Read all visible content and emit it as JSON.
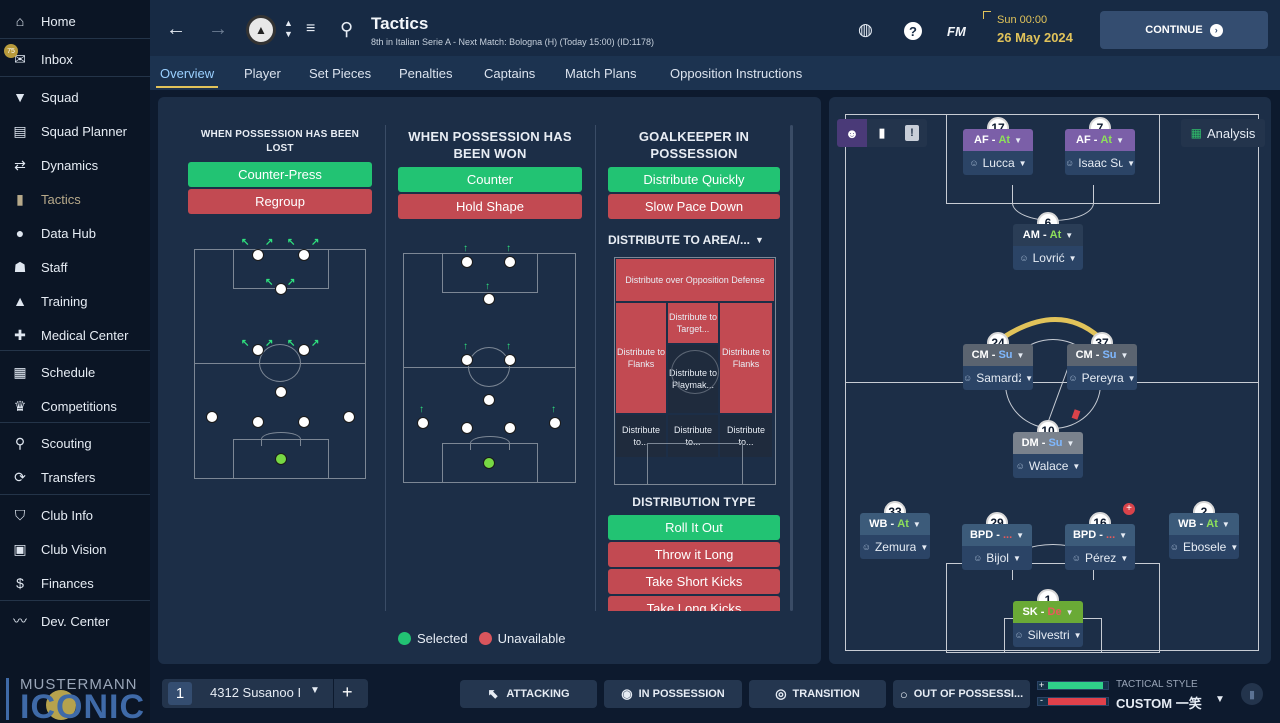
{
  "sidebar": {
    "items": [
      {
        "label": "Home",
        "icon": "home-icon",
        "glyph": "⌂"
      },
      {
        "label": "Inbox",
        "icon": "inbox-icon",
        "glyph": "✉",
        "badge": "75"
      },
      {
        "label": "Squad",
        "icon": "shirt-icon",
        "glyph": "👕"
      },
      {
        "label": "Squad Planner",
        "icon": "clipboard-icon",
        "glyph": "▤"
      },
      {
        "label": "Dynamics",
        "icon": "dynamics-icon",
        "glyph": "⇄"
      },
      {
        "label": "Tactics",
        "icon": "tactics-board-icon",
        "glyph": "▦"
      },
      {
        "label": "Data Hub",
        "icon": "data-hub-icon",
        "glyph": "●"
      },
      {
        "label": "Staff",
        "icon": "staff-icon",
        "glyph": "☗"
      },
      {
        "label": "Training",
        "icon": "training-cone-icon",
        "glyph": "▲"
      },
      {
        "label": "Medical Center",
        "icon": "medical-icon",
        "glyph": "✚"
      },
      {
        "label": "Schedule",
        "icon": "calendar-icon",
        "glyph": "▦"
      },
      {
        "label": "Competitions",
        "icon": "trophy-icon",
        "glyph": "🏆"
      },
      {
        "label": "Scouting",
        "icon": "search-icon",
        "glyph": "⚲"
      },
      {
        "label": "Transfers",
        "icon": "transfer-icon",
        "glyph": "⟳"
      },
      {
        "label": "Club Info",
        "icon": "shield-icon",
        "glyph": "⛉"
      },
      {
        "label": "Club Vision",
        "icon": "briefcase-icon",
        "glyph": "▣"
      },
      {
        "label": "Finances",
        "icon": "money-icon",
        "glyph": "$"
      },
      {
        "label": "Dev. Center",
        "icon": "dev-center-icon",
        "glyph": "〰"
      }
    ],
    "brand": {
      "line1": "MUSTERMANN",
      "line2": "ICONIC"
    }
  },
  "topbar": {
    "title": "Tactics",
    "subtitle": "8th in Italian Serie A - Next Match: Bologna (H) (Today 15:00) (ID:1178)",
    "time": "Sun 00:00",
    "date": "26 May 2024",
    "continue_label": "CONTINUE",
    "fm_label": "FM",
    "help": "?"
  },
  "tabs": [
    "Overview",
    "Player",
    "Set Pieces",
    "Penalties",
    "Captains",
    "Match Plans",
    "Opposition Instructions"
  ],
  "left_panel": {
    "col1": {
      "title": "WHEN POSSESSION HAS BEEN LOST",
      "options": [
        {
          "label": "Counter-Press",
          "state": "selected"
        },
        {
          "label": "Regroup",
          "state": "unavailable"
        }
      ]
    },
    "col2": {
      "title": "WHEN POSSESSION HAS BEEN WON",
      "options": [
        {
          "label": "Counter",
          "state": "selected"
        },
        {
          "label": "Hold Shape",
          "state": "unavailable"
        }
      ]
    },
    "col3": {
      "title": "GOALKEEPER IN POSSESSION",
      "options": [
        {
          "label": "Distribute Quickly",
          "state": "selected"
        },
        {
          "label": "Slow Pace Down",
          "state": "unavailable"
        }
      ],
      "area_title": "DISTRIBUTE TO AREA/...",
      "area_cells": [
        "Distribute over Opposition Defense",
        "Distribute to Target...",
        "Distribute to Flanks",
        "Distribute to Playmak...",
        "Distribute to Flanks",
        "Distribute to...",
        "Distribute to...",
        "Distribute to..."
      ],
      "dist_type_title": "DISTRIBUTION TYPE",
      "dist_types": [
        {
          "label": "Roll It Out",
          "state": "selected"
        },
        {
          "label": "Throw it Long",
          "state": "unavailable"
        },
        {
          "label": "Take Short Kicks",
          "state": "unavailable"
        },
        {
          "label": "Take Long Kicks",
          "state": "unavailable"
        }
      ]
    },
    "legend": {
      "selected": "Selected",
      "unavailable": "Unavailable"
    }
  },
  "right_panel": {
    "analysis_label": "Analysis",
    "players": [
      {
        "num": "17",
        "role": "AF",
        "duty": "At",
        "name": "Lucca",
        "role_color": "#7b5fa8"
      },
      {
        "num": "7",
        "role": "AF",
        "duty": "At",
        "name": "Isaac Succes.",
        "role_color": "#7b5fa8"
      },
      {
        "num": "6",
        "role": "AM",
        "duty": "At",
        "name": "Lovrić",
        "role_color": "#2a3d56"
      },
      {
        "num": "24",
        "role": "CM",
        "duty": "Su",
        "name": "Samardžić",
        "role_color": "#5b6470"
      },
      {
        "num": "37",
        "role": "CM",
        "duty": "Su",
        "name": "Pereyra",
        "role_color": "#5b6470"
      },
      {
        "num": "10",
        "role": "DM",
        "duty": "Su",
        "name": "Walace",
        "role_color": "#7a828d"
      },
      {
        "num": "33",
        "role": "WB",
        "duty": "At",
        "name": "Zemura",
        "role_color": "#3c5b7a"
      },
      {
        "num": "29",
        "role": "BPD",
        "duty": "...",
        "name": "Bijol",
        "role_color": "#3c5b7a"
      },
      {
        "num": "16",
        "role": "BPD",
        "duty": "...",
        "name": "Pérez",
        "role_color": "#3c5b7a"
      },
      {
        "num": "2",
        "role": "WB",
        "duty": "At",
        "name": "Ebosele",
        "role_color": "#3c5b7a"
      },
      {
        "num": "1",
        "role": "SK",
        "duty": "De",
        "name": "Silvestri",
        "role_color": "#6aaa36"
      }
    ]
  },
  "bottom": {
    "slot_number": "1",
    "tactic_name": "4312 Susanoo I",
    "add": "+",
    "phases": [
      "ATTACKING",
      "IN POSSESSION",
      "TRANSITION",
      "OUT OF POSSESSI..."
    ],
    "tactical_style_label": "TACTICAL STYLE",
    "tactical_style_value": "CUSTOM 一笑"
  }
}
